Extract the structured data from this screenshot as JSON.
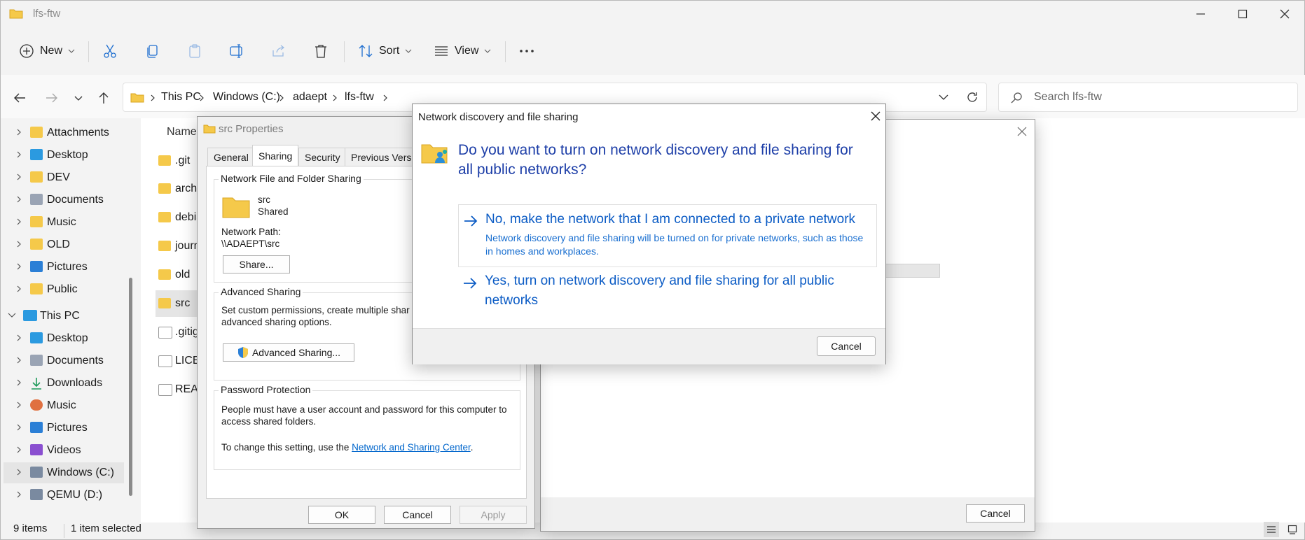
{
  "window": {
    "title": "lfs-ftw"
  },
  "toolbar": {
    "new_label": "New",
    "sort_label": "Sort",
    "view_label": "View"
  },
  "address": {
    "crumbs": [
      "This PC",
      "Windows (C:)",
      "adaept",
      "lfs-ftw"
    ]
  },
  "search": {
    "placeholder": "Search lfs-ftw"
  },
  "sidebar": {
    "items": [
      {
        "label": "Attachments"
      },
      {
        "label": "Desktop"
      },
      {
        "label": "DEV"
      },
      {
        "label": "Documents"
      },
      {
        "label": "Music"
      },
      {
        "label": "OLD"
      },
      {
        "label": "Pictures"
      },
      {
        "label": "Public"
      },
      {
        "label": "This PC"
      },
      {
        "label": "Desktop"
      },
      {
        "label": "Documents"
      },
      {
        "label": "Downloads"
      },
      {
        "label": "Music"
      },
      {
        "label": "Pictures"
      },
      {
        "label": "Videos"
      },
      {
        "label": "Windows (C:)"
      },
      {
        "label": "QEMU (D:)"
      }
    ]
  },
  "content": {
    "column_name": "Name",
    "files": [
      ".git",
      "archl",
      "debia",
      "journ",
      "old",
      "src",
      ".gitig",
      "LICEN",
      "READ"
    ]
  },
  "status": {
    "items": "9 items",
    "selected": "1 item selected"
  },
  "props": {
    "title": "src Properties",
    "tabs": [
      "General",
      "Sharing",
      "Security",
      "Previous Versio"
    ],
    "group_sharing": "Network File and Folder Sharing",
    "folder_name": "src",
    "folder_state": "Shared",
    "network_path_label": "Network Path:",
    "network_path": "\\\\ADAEPT\\src",
    "share_button": "Share...",
    "group_advanced": "Advanced Sharing",
    "advanced_text": "Set custom permissions, create multiple shar\nadvanced sharing options.",
    "advanced_button": "Advanced Sharing...",
    "group_password": "Password Protection",
    "password_text": "People must have a user account and password for this computer to access shared folders.",
    "password_change_prefix": "To change this setting, use the ",
    "password_link": "Network and Sharing Center",
    "password_suffix": ".",
    "ok": "OK",
    "cancel": "Cancel",
    "apply": "Apply"
  },
  "advanced_dialog": {
    "cancel": "Cancel"
  },
  "network_dialog": {
    "title": "Network discovery and file sharing",
    "question": "Do you want to turn on network discovery and file sharing for all public networks?",
    "option_no": "No, make the network that I am connected to a private network",
    "option_no_sub": "Network discovery and file sharing will be turned on for private networks, such as those in homes and workplaces.",
    "option_yes": "Yes, turn on network discovery and file sharing for all public networks",
    "cancel": "Cancel"
  },
  "colors": {
    "accent": "#0c5cc5",
    "question": "#1e3fa8",
    "folder": "#f5c94a"
  }
}
